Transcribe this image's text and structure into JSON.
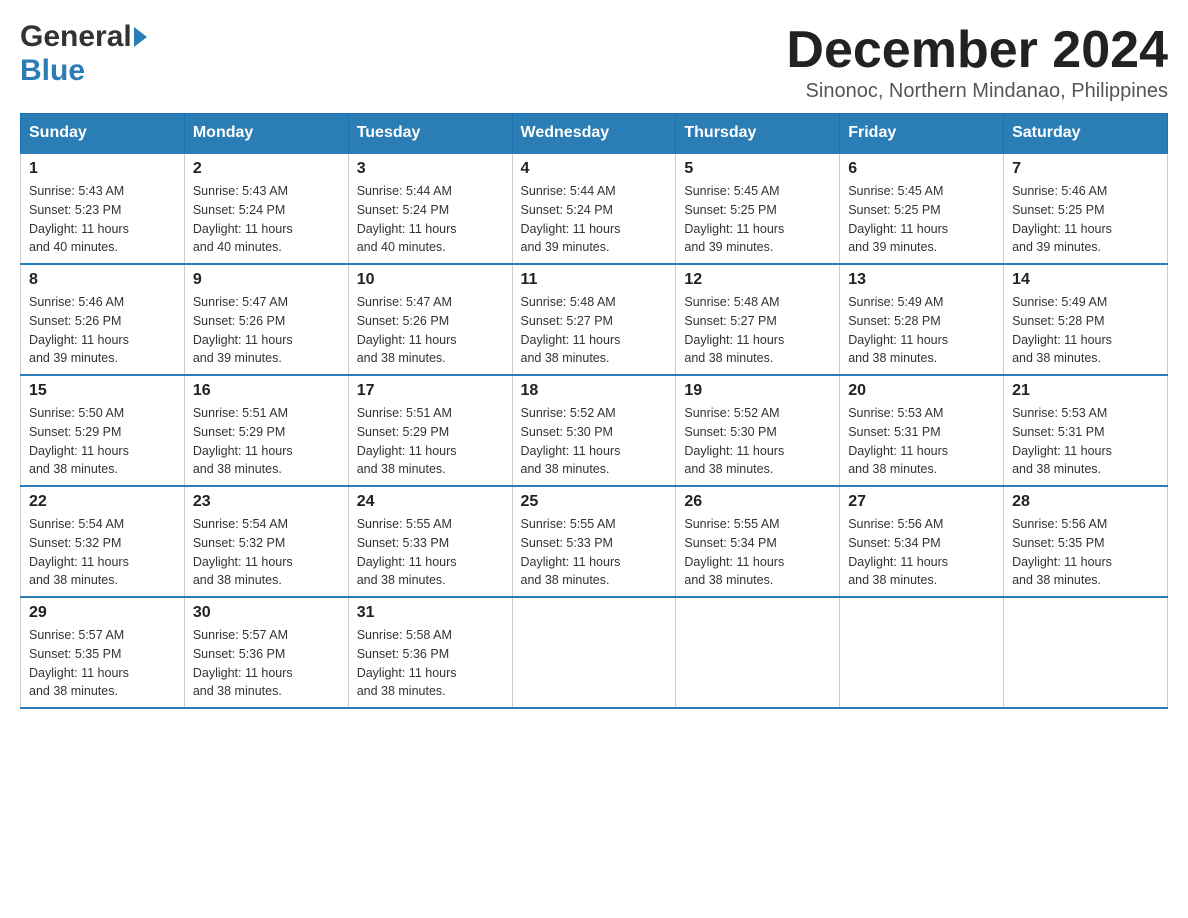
{
  "header": {
    "logo_general": "General",
    "logo_blue": "Blue",
    "month_title": "December 2024",
    "location": "Sinonoc, Northern Mindanao, Philippines"
  },
  "days_of_week": [
    "Sunday",
    "Monday",
    "Tuesday",
    "Wednesday",
    "Thursday",
    "Friday",
    "Saturday"
  ],
  "weeks": [
    [
      {
        "day": "1",
        "sunrise": "5:43 AM",
        "sunset": "5:23 PM",
        "daylight": "11 hours and 40 minutes."
      },
      {
        "day": "2",
        "sunrise": "5:43 AM",
        "sunset": "5:24 PM",
        "daylight": "11 hours and 40 minutes."
      },
      {
        "day": "3",
        "sunrise": "5:44 AM",
        "sunset": "5:24 PM",
        "daylight": "11 hours and 40 minutes."
      },
      {
        "day": "4",
        "sunrise": "5:44 AM",
        "sunset": "5:24 PM",
        "daylight": "11 hours and 39 minutes."
      },
      {
        "day": "5",
        "sunrise": "5:45 AM",
        "sunset": "5:25 PM",
        "daylight": "11 hours and 39 minutes."
      },
      {
        "day": "6",
        "sunrise": "5:45 AM",
        "sunset": "5:25 PM",
        "daylight": "11 hours and 39 minutes."
      },
      {
        "day": "7",
        "sunrise": "5:46 AM",
        "sunset": "5:25 PM",
        "daylight": "11 hours and 39 minutes."
      }
    ],
    [
      {
        "day": "8",
        "sunrise": "5:46 AM",
        "sunset": "5:26 PM",
        "daylight": "11 hours and 39 minutes."
      },
      {
        "day": "9",
        "sunrise": "5:47 AM",
        "sunset": "5:26 PM",
        "daylight": "11 hours and 39 minutes."
      },
      {
        "day": "10",
        "sunrise": "5:47 AM",
        "sunset": "5:26 PM",
        "daylight": "11 hours and 38 minutes."
      },
      {
        "day": "11",
        "sunrise": "5:48 AM",
        "sunset": "5:27 PM",
        "daylight": "11 hours and 38 minutes."
      },
      {
        "day": "12",
        "sunrise": "5:48 AM",
        "sunset": "5:27 PM",
        "daylight": "11 hours and 38 minutes."
      },
      {
        "day": "13",
        "sunrise": "5:49 AM",
        "sunset": "5:28 PM",
        "daylight": "11 hours and 38 minutes."
      },
      {
        "day": "14",
        "sunrise": "5:49 AM",
        "sunset": "5:28 PM",
        "daylight": "11 hours and 38 minutes."
      }
    ],
    [
      {
        "day": "15",
        "sunrise": "5:50 AM",
        "sunset": "5:29 PM",
        "daylight": "11 hours and 38 minutes."
      },
      {
        "day": "16",
        "sunrise": "5:51 AM",
        "sunset": "5:29 PM",
        "daylight": "11 hours and 38 minutes."
      },
      {
        "day": "17",
        "sunrise": "5:51 AM",
        "sunset": "5:29 PM",
        "daylight": "11 hours and 38 minutes."
      },
      {
        "day": "18",
        "sunrise": "5:52 AM",
        "sunset": "5:30 PM",
        "daylight": "11 hours and 38 minutes."
      },
      {
        "day": "19",
        "sunrise": "5:52 AM",
        "sunset": "5:30 PM",
        "daylight": "11 hours and 38 minutes."
      },
      {
        "day": "20",
        "sunrise": "5:53 AM",
        "sunset": "5:31 PM",
        "daylight": "11 hours and 38 minutes."
      },
      {
        "day": "21",
        "sunrise": "5:53 AM",
        "sunset": "5:31 PM",
        "daylight": "11 hours and 38 minutes."
      }
    ],
    [
      {
        "day": "22",
        "sunrise": "5:54 AM",
        "sunset": "5:32 PM",
        "daylight": "11 hours and 38 minutes."
      },
      {
        "day": "23",
        "sunrise": "5:54 AM",
        "sunset": "5:32 PM",
        "daylight": "11 hours and 38 minutes."
      },
      {
        "day": "24",
        "sunrise": "5:55 AM",
        "sunset": "5:33 PM",
        "daylight": "11 hours and 38 minutes."
      },
      {
        "day": "25",
        "sunrise": "5:55 AM",
        "sunset": "5:33 PM",
        "daylight": "11 hours and 38 minutes."
      },
      {
        "day": "26",
        "sunrise": "5:55 AM",
        "sunset": "5:34 PM",
        "daylight": "11 hours and 38 minutes."
      },
      {
        "day": "27",
        "sunrise": "5:56 AM",
        "sunset": "5:34 PM",
        "daylight": "11 hours and 38 minutes."
      },
      {
        "day": "28",
        "sunrise": "5:56 AM",
        "sunset": "5:35 PM",
        "daylight": "11 hours and 38 minutes."
      }
    ],
    [
      {
        "day": "29",
        "sunrise": "5:57 AM",
        "sunset": "5:35 PM",
        "daylight": "11 hours and 38 minutes."
      },
      {
        "day": "30",
        "sunrise": "5:57 AM",
        "sunset": "5:36 PM",
        "daylight": "11 hours and 38 minutes."
      },
      {
        "day": "31",
        "sunrise": "5:58 AM",
        "sunset": "5:36 PM",
        "daylight": "11 hours and 38 minutes."
      },
      null,
      null,
      null,
      null
    ]
  ],
  "labels": {
    "sunrise": "Sunrise: ",
    "sunset": "Sunset: ",
    "daylight": "Daylight: "
  }
}
